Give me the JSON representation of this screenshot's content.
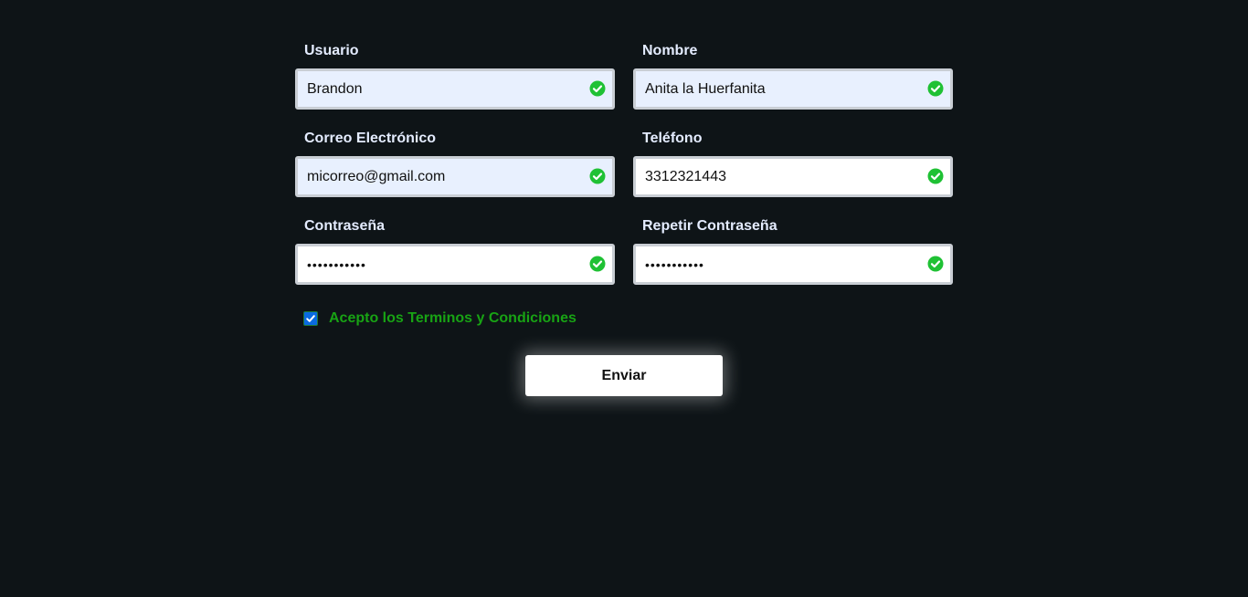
{
  "form": {
    "fields": [
      {
        "label": "Usuario",
        "value": "Brandon",
        "type": "text",
        "valid": true
      },
      {
        "label": "Nombre",
        "value": "Anita la Huerfanita",
        "type": "text",
        "valid": true
      },
      {
        "label": "Correo Electrónico",
        "value": "micorreo@gmail.com",
        "type": "email",
        "valid": true
      },
      {
        "label": "Teléfono",
        "value": "3312321443",
        "type": "tel",
        "valid": true
      },
      {
        "label": "Contraseña",
        "value": "12345678901",
        "type": "password",
        "valid": true
      },
      {
        "label": "Repetir Contraseña",
        "value": "12345678901",
        "type": "password",
        "valid": true
      }
    ],
    "terms": {
      "label": "Acepto los Terminos y Condiciones",
      "checked": true
    },
    "submit_label": "Enviar"
  },
  "colors": {
    "background": "#0e1417",
    "label": "#e4ecff",
    "valid_icon": "#1fc134",
    "terms_text": "#18a314",
    "checkbox": "#0a6ae0"
  },
  "icons": {
    "valid": "check-circle-icon",
    "checkbox": "checkmark-icon"
  }
}
